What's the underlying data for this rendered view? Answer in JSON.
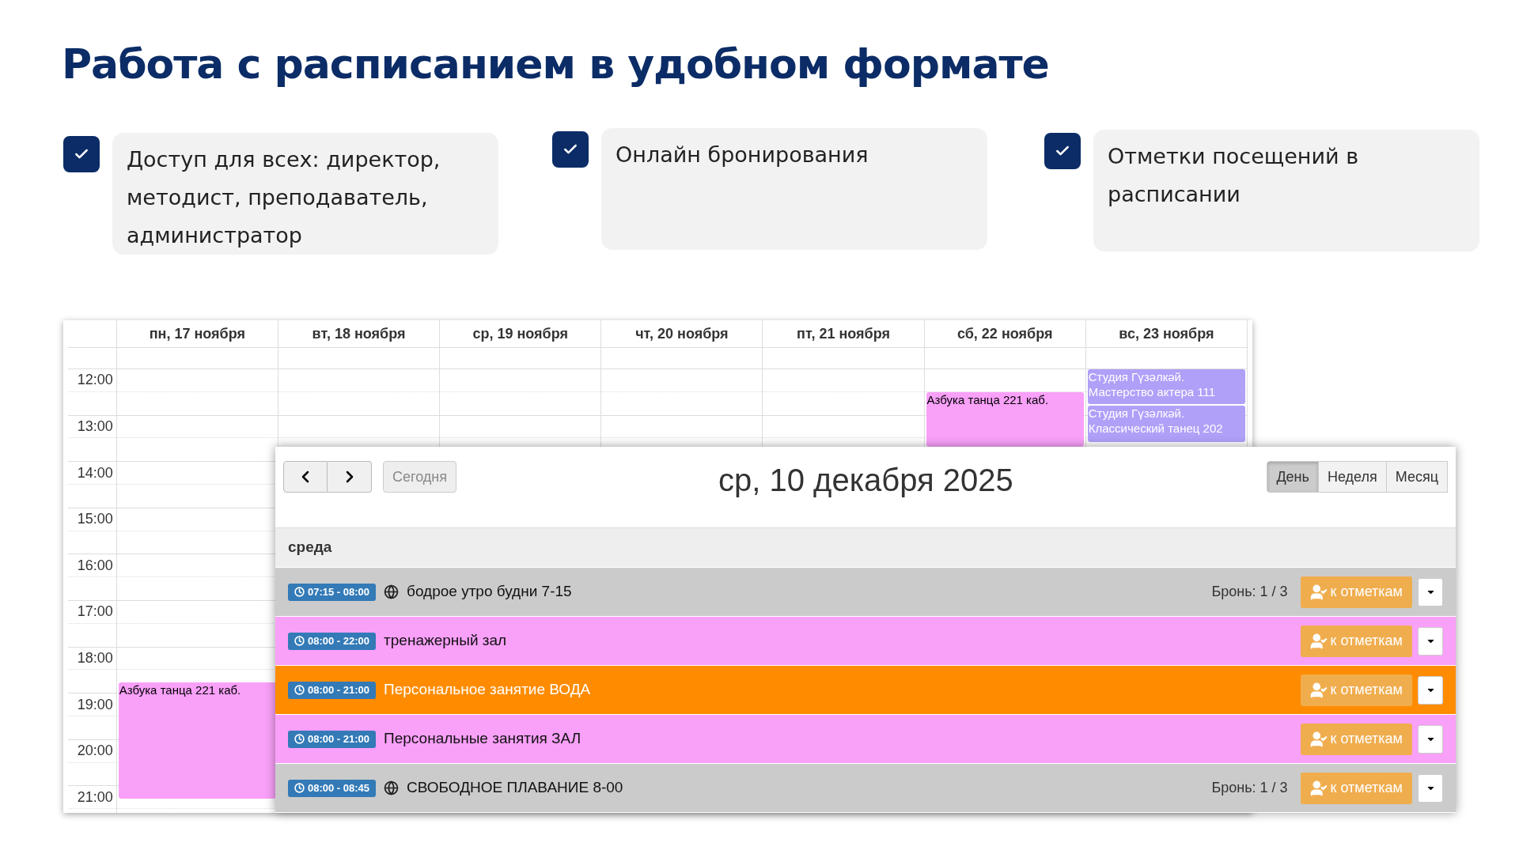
{
  "title": "Работа с расписанием в удобном формате",
  "features": [
    {
      "text": "Доступ для всех: директор, методист, преподаватель, администратор",
      "checked": true
    },
    {
      "text": "Онлайн бронирования",
      "checked": true
    },
    {
      "text": "Отметки посещений в расписании",
      "checked": true
    }
  ],
  "week_view": {
    "days": [
      {
        "label": "пн, 17 ноября",
        "events": [
          {
            "label": "Азбука танца 221 каб.",
            "color": "#f9a0f9"
          }
        ]
      },
      {
        "label": "вт, 18 ноября"
      },
      {
        "label": "ср, 19 ноября"
      },
      {
        "label": "чт, 20 ноября"
      },
      {
        "label": "пт, 21 ноября"
      },
      {
        "label": "сб, 22 ноября",
        "events": [
          {
            "label": "Азбука танца 221 каб.",
            "color": "#f9a0f9"
          }
        ]
      },
      {
        "label": "вс, 23 ноября",
        "events": [
          {
            "label": "Студия Гүзәлкәй. Мастерство актера 111",
            "color": "#b0a0f8"
          },
          {
            "label": "Студия Гүзәлкәй. Классический танец 202",
            "color": "#b0a0f8"
          }
        ]
      }
    ],
    "times": [
      "12:00",
      "13:00",
      "14:00",
      "15:00",
      "16:00",
      "17:00",
      "18:00",
      "19:00",
      "20:00",
      "21:00"
    ]
  },
  "day_view": {
    "title": "ср, 10 декабря 2025",
    "today_button": "Сегодня",
    "views": [
      {
        "label": "День",
        "selected": true
      },
      {
        "label": "Неделя",
        "selected": false
      },
      {
        "label": "Месяц",
        "selected": false
      }
    ],
    "day_header": "среда",
    "rows": [
      {
        "time": "07:15 - 08:00",
        "online": true,
        "name": "бодрое утро будни 7-15",
        "booking": "Бронь: 1 / 3",
        "color": "#cbcbcb",
        "button": "к отметкам"
      },
      {
        "time": "08:00 - 22:00",
        "online": false,
        "name": "тренажерный зал",
        "color": "#f9a0f9",
        "button": "к отметкам"
      },
      {
        "time": "08:00 - 21:00",
        "online": false,
        "name": "Персональное занятие ВОДА",
        "color": "#ff8c00",
        "button": "к отметкам"
      },
      {
        "time": "08:00 - 21:00",
        "online": false,
        "name": "Персональные занятия ЗАЛ",
        "color": "#f9a0f9",
        "button": "к отметкам"
      },
      {
        "time": "08:00 - 08:45",
        "online": true,
        "name": "СВОБОДНОЕ ПЛАВАНИЕ 8-00",
        "booking": "Бронь: 1 / 3",
        "color": "#cbcbcb",
        "button": "к отметкам"
      }
    ]
  }
}
